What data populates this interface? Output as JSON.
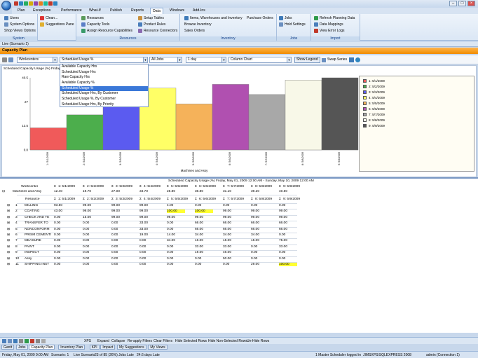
{
  "titlebar": {
    "quick_access_colors": [
      "#c0392b",
      "#2e86c1",
      "#27ae60",
      "#d4ac0d",
      "#8e44ad",
      "#e67e22",
      "#1abc9c",
      "#c0392b",
      "#2e86c1"
    ]
  },
  "menu": [
    "Plan",
    "Exceptions",
    "Performance",
    "What-If",
    "Publish",
    "Reports",
    "Data",
    "Windows",
    "Add-Ins"
  ],
  "menu_active": "Data",
  "ribbon": {
    "system": {
      "label": "System",
      "items": [
        "Users",
        "System Options",
        "Shop Views Options",
        "Clean...",
        "Suggestions Pane"
      ]
    },
    "resources": {
      "label": "Resources",
      "items": [
        "Resources",
        "Capacity Tools",
        "Assign Resource Capabilities",
        "Setup Tables",
        "Product Rules",
        "Resource Connectors"
      ]
    },
    "inventory": {
      "label": "Inventory",
      "items": [
        "Items, Warehouses and Inventory",
        "Browse Inventory",
        "Sales Orders",
        "Purchase Orders"
      ]
    },
    "jobs": {
      "label": "Jobs",
      "items": [
        "Jobs",
        "Hold Settings"
      ]
    },
    "import": {
      "label": "Import",
      "items": [
        "Refresh Planning Data",
        "Data Mappings",
        "View Error Logs"
      ]
    }
  },
  "doc_tab": "Live (Scenario 1)",
  "panel_title": "Capacity Plan",
  "toolbar": {
    "group_by": "Workcenters",
    "measure": "Scheduled Usage %",
    "jobs_filter": "All Jobs",
    "bucket": "1 day",
    "chart_type": "Column Chart",
    "show_legend": "Show Legend",
    "swap_series": "Swap Series"
  },
  "dropdown_options": [
    "Available Capacity Hrs",
    "Scheduled Usage Hrs",
    "Raw Capacity Hrs",
    "Available Capacity %",
    "Scheduled Usage %",
    "Scheduled Usage Hrs, By Customer",
    "Scheduled Usage %, By Customer",
    "Scheduled Usage Hrs, By Priority"
  ],
  "dropdown_selected_index": 4,
  "chart_data": {
    "type": "bar",
    "title": "Scheduled Capacity Usage (%) Friday, M",
    "xlabel": "Machines and Assy",
    "ylabel": "",
    "yticks": [
      "40.5",
      "27",
      "13.5",
      "0.0"
    ],
    "ylim": [
      0,
      40.5
    ],
    "categories": [
      "1: 5/1/2009",
      "2: 5/2/2009",
      "3: 5/3/2009",
      "4: 5/4/2009",
      "5: 5/5/2009",
      "6: 5/6/2009",
      "7: 5/7/2009",
      "8: 5/8/2009",
      "9: 5/9/2009"
    ],
    "values": [
      12.4,
      19.7,
      27.0,
      34.7,
      25.8,
      36.8,
      31.1,
      39.2,
      40.5
    ],
    "colors": [
      "#f05a5a",
      "#4cae4c",
      "#5b5bf0",
      "#ffff66",
      "#f5b25a",
      "#b050b0",
      "#a8a8a8",
      "#f8f8e8",
      "#555555"
    ],
    "legend": [
      "1: 5/1/2009",
      "2: 5/2/2009",
      "3: 5/3/2009",
      "4: 5/4/2009",
      "5: 5/5/2009",
      "6: 5/6/2009",
      "7: 5/7/2009",
      "8: 5/8/2009",
      "9: 5/9/2009"
    ],
    "legend_position": "right",
    "grid": false
  },
  "grid": {
    "title": "Scheduled Capacity Usage (%) Friday, May 01, 2009 12:00 AM - Sunday, May 10, 2009 12:00 AM",
    "workcenter_label": "Workcenter",
    "workcenter_name": "Machines and Assy",
    "col_headers": [
      "1: 5/1/2009",
      "2: 5/2/2009",
      "3: 5/3/2009",
      "4: 5/4/2009",
      "5: 5/5/2009",
      "6: 5/6/2009",
      "7: 5/7/2009",
      "8: 5/8/2009",
      "9: 5/9/2009"
    ],
    "workcenter_totals": [
      "12.40",
      "19.70",
      "27.00",
      "34.70",
      "25.80",
      "36.80",
      "31.10",
      "39.20",
      "40.50"
    ],
    "resource_label": "Resource",
    "rows": [
      {
        "n": "1",
        "name": "MILLING",
        "v": [
          "93.50",
          "99.00",
          "99.00",
          "99.00",
          "4.00",
          "0.00",
          "0.00",
          "0.00",
          "0.00"
        ],
        "hl": []
      },
      {
        "n": "2",
        "name": "COATING",
        "v": [
          "43.00",
          "99.00",
          "99.00",
          "99.00",
          "100.00",
          "100.00",
          "99.00",
          "99.00",
          "99.00"
        ],
        "hl": [
          4,
          5
        ]
      },
      {
        "n": "3",
        "name": "CHECK AND TE",
        "v": [
          "0.00",
          "15.00",
          "99.00",
          "99.00",
          "99.00",
          "99.00",
          "99.00",
          "99.00",
          "99.00"
        ],
        "hl": []
      },
      {
        "n": "4",
        "name": "TRANSFER TO",
        "v": [
          "0.00",
          "0.00",
          "0.00",
          "33.00",
          "0.00",
          "66.00",
          "66.00",
          "66.00",
          "66.00"
        ],
        "hl": []
      },
      {
        "n": "5",
        "name": "NONCONFORM",
        "v": [
          "0.00",
          "0.00",
          "0.00",
          "33.00",
          "0.00",
          "66.00",
          "66.00",
          "66.00",
          "66.00"
        ],
        "hl": []
      },
      {
        "n": "6",
        "name": "PRISM CEMENTI",
        "v": [
          "0.00",
          "0.00",
          "0.00",
          "19.00",
          "14.00",
          "34.00",
          "34.00",
          "34.00",
          "0.00"
        ],
        "hl": []
      },
      {
        "n": "7",
        "name": "MEASURE",
        "v": [
          "0.00",
          "0.00",
          "0.00",
          "0.00",
          "34.00",
          "16.00",
          "15.00",
          "15.00",
          "75.00"
        ],
        "hl": []
      },
      {
        "n": "8",
        "name": "PAINT",
        "v": [
          "0.00",
          "0.00",
          "0.00",
          "0.00",
          "0.00",
          "33.00",
          "33.00",
          "0.00",
          "33.00"
        ],
        "hl": []
      },
      {
        "n": "9",
        "name": "INSPECT",
        "v": [
          "0.00",
          "0.00",
          "0.00",
          "0.00",
          "0.00",
          "19.00",
          "46.00",
          "0.00",
          "0.00"
        ],
        "hl": []
      },
      {
        "n": "10",
        "name": "Assy",
        "v": [
          "0.00",
          "0.00",
          "0.00",
          "0.00",
          "0.00",
          "0.00",
          "50.00",
          "0.00",
          "0.00"
        ],
        "hl": []
      },
      {
        "n": "11",
        "name": "SHIPPING INST",
        "v": [
          "0.00",
          "0.00",
          "0.00",
          "0.00",
          "0.00",
          "0.00",
          "0.00",
          "29.00",
          "100.00"
        ],
        "hl": [
          8
        ]
      }
    ],
    "highlight_color": "#ffff33"
  },
  "bottom_buttons": [
    "XPS",
    "Expand",
    "Collapse",
    "Re-apply Filters",
    "Clear Filters",
    "Hide Selected Rows",
    "Hide Non-Selected Rows",
    "Un-Hide Rows"
  ],
  "view_tabs": [
    "Gantt",
    "Jobs",
    "Capacity Plan",
    "Inventory Plan",
    "KPI",
    "Impact",
    "My Suggestions",
    "My Views"
  ],
  "view_tab_active": "Capacity Plan",
  "status": {
    "datetime": "Friday, May 01, 2009 9:00 AM",
    "scenario": "Scenario: 1",
    "live": "Live Scenario",
    "jobs_late": "23 of 85 (26%) Jobs Late",
    "days_late": "24.6 days Late",
    "user": "1 Master Scheduler logged in",
    "server": "JIMSXPS\\SQLEXPRESS 2008",
    "connection": "admin (Connection 1)"
  }
}
